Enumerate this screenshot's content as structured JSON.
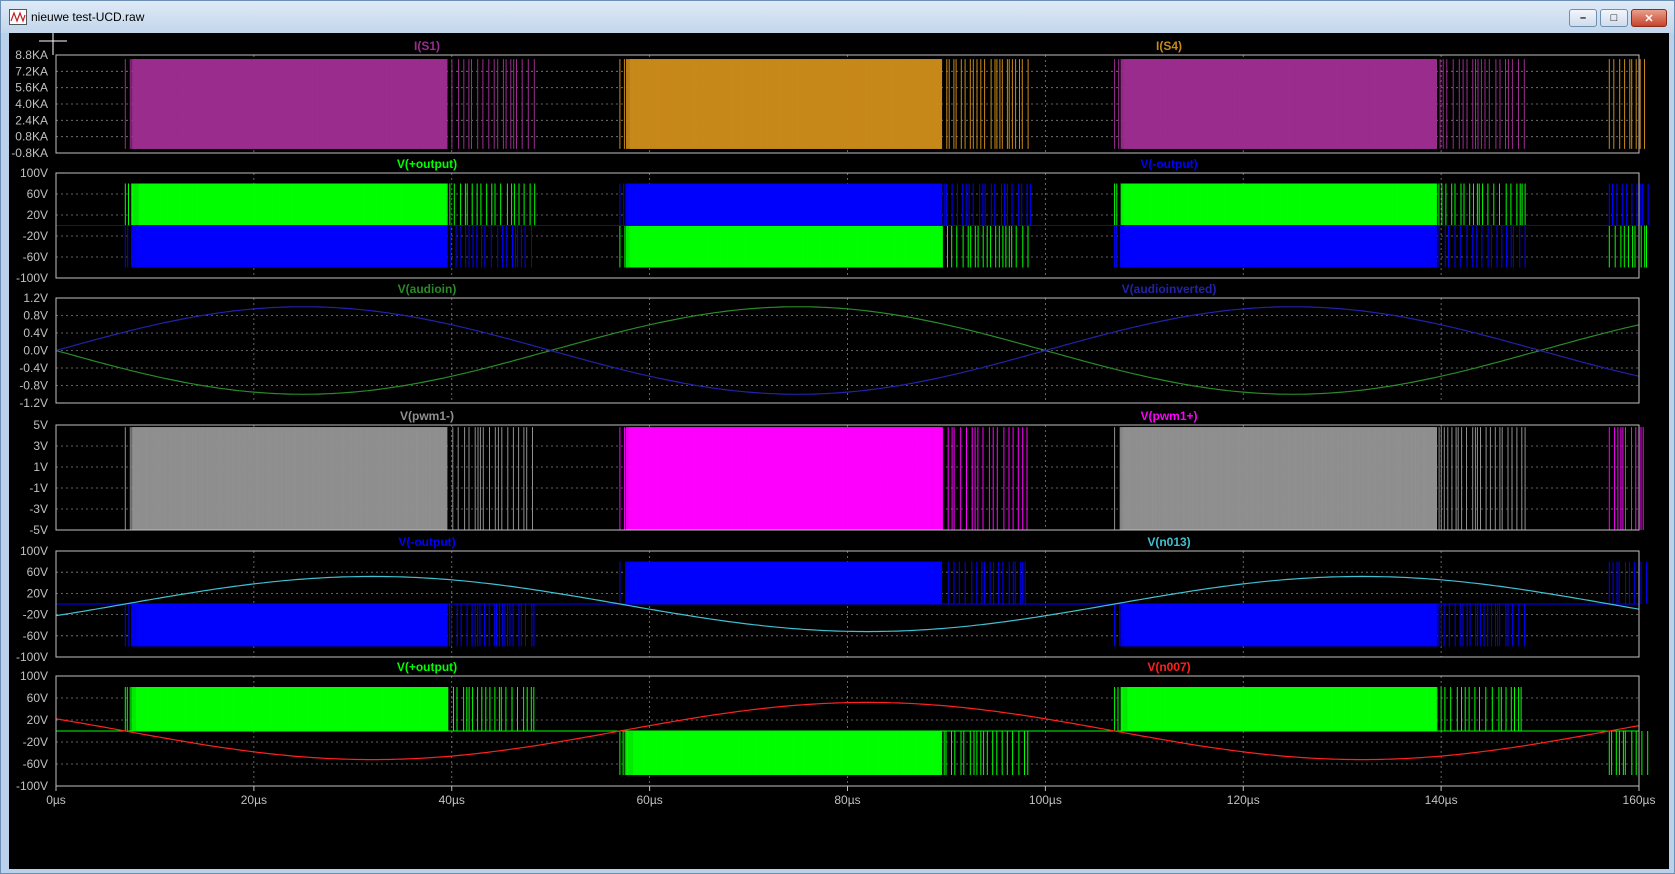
{
  "window": {
    "title": "nieuwe test-UCD.raw",
    "app_icon": "ltspice-waveform-icon",
    "buttons": {
      "minimize": "minimize-icon",
      "maximize": "maximize-icon",
      "close": "close-icon"
    }
  },
  "chart_data": [
    {
      "type": "line",
      "pane": 1,
      "yunit": "A",
      "yticks": [
        "8.8KA",
        "7.2KA",
        "5.6KA",
        "4.0KA",
        "2.4KA",
        "0.8KA",
        "-0.8KA"
      ],
      "ylim": [
        -800,
        8800
      ],
      "grid": true,
      "series": [
        {
          "name": "I(S1)",
          "color": "#9b2d8f",
          "kind": "pwm",
          "low": -400,
          "high": 8400,
          "active_ms": [
            [
              7,
              48.5
            ],
            [
              107,
              148.5
            ]
          ]
        },
        {
          "name": "I(S4)",
          "color": "#c8891a",
          "kind": "pwm",
          "low": -400,
          "high": 8400,
          "active_ms": [
            [
              57,
              98.5
            ],
            [
              157,
              161
            ]
          ]
        }
      ]
    },
    {
      "type": "line",
      "pane": 2,
      "yunit": "V",
      "yticks": [
        "100V",
        "60V",
        "20V",
        "-20V",
        "-60V",
        "-100V"
      ],
      "ylim": [
        -100,
        100
      ],
      "grid": true,
      "series": [
        {
          "name": "V(+output)",
          "color": "#00ff00",
          "kind": "bipolar",
          "amp": 80,
          "phase": 0
        },
        {
          "name": "V(-output)",
          "color": "#0000ff",
          "kind": "bipolar",
          "amp": 80,
          "phase": 1
        }
      ]
    },
    {
      "type": "line",
      "pane": 3,
      "yunit": "V",
      "yticks": [
        "1.2V",
        "0.8V",
        "0.4V",
        "0.0V",
        "-0.4V",
        "-0.8V",
        "-1.2V"
      ],
      "ylim": [
        -1.2,
        1.2
      ],
      "grid": true,
      "series": [
        {
          "name": "V(audioin)",
          "color": "#2a8a2a",
          "kind": "sine",
          "amp": -1.0,
          "period_us": 100,
          "phase_us": 0
        },
        {
          "name": "V(audioinverted)",
          "color": "#2222aa",
          "kind": "sine",
          "amp": 1.0,
          "period_us": 100,
          "phase_us": 0
        }
      ]
    },
    {
      "type": "line",
      "pane": 4,
      "yunit": "V",
      "yticks": [
        "5V",
        "3V",
        "1V",
        "-1V",
        "-3V",
        "-5V"
      ],
      "ylim": [
        -5,
        5
      ],
      "grid": true,
      "series": [
        {
          "name": "V(pwm1-)",
          "color": "#909090",
          "kind": "pwm",
          "low": -5,
          "high": 4.8,
          "active_ms": [
            [
              7,
              48.5
            ],
            [
              107,
              148.5
            ]
          ]
        },
        {
          "name": "V(pwm1+)",
          "color": "#ff00ff",
          "kind": "pwm",
          "low": -5,
          "high": 4.8,
          "active_ms": [
            [
              57,
              98.5
            ],
            [
              157,
              161
            ]
          ]
        }
      ]
    },
    {
      "type": "line",
      "pane": 5,
      "yunit": "V",
      "yticks": [
        "100V",
        "60V",
        "20V",
        "-20V",
        "-60V",
        "-100V"
      ],
      "ylim": [
        -100,
        100
      ],
      "grid": true,
      "series": [
        {
          "name": "V(-output)",
          "color": "#0000ff",
          "kind": "bipolar",
          "amp": 80,
          "phase": 1
        },
        {
          "name": "V(n013)",
          "color": "#40c0d0",
          "kind": "sine",
          "amp": 52,
          "period_us": 100,
          "phase_us": 7
        }
      ]
    },
    {
      "type": "line",
      "pane": 6,
      "yunit": "V",
      "yticks": [
        "100V",
        "60V",
        "20V",
        "-20V",
        "-60V",
        "-100V"
      ],
      "ylim": [
        -100,
        100
      ],
      "grid": true,
      "series": [
        {
          "name": "V(+output)",
          "color": "#00ff00",
          "kind": "bipolar",
          "amp": 80,
          "phase": 0
        },
        {
          "name": "V(n007)",
          "color": "#ff2020",
          "kind": "sine",
          "amp": 52,
          "period_us": 100,
          "phase_us": 7,
          "invert": true
        }
      ]
    }
  ],
  "x_axis": {
    "unit": "µs",
    "xlim": [
      0,
      160
    ],
    "ticks": [
      "0µs",
      "20µs",
      "40µs",
      "60µs",
      "80µs",
      "100µs",
      "120µs",
      "140µs",
      "160µs"
    ],
    "tick_values": [
      0,
      20,
      40,
      60,
      80,
      100,
      120,
      140,
      160
    ]
  },
  "colors": {
    "background": "#000000",
    "axis": "#c0c0c0",
    "grid": "#808080",
    "label": "#c0c0c0"
  }
}
